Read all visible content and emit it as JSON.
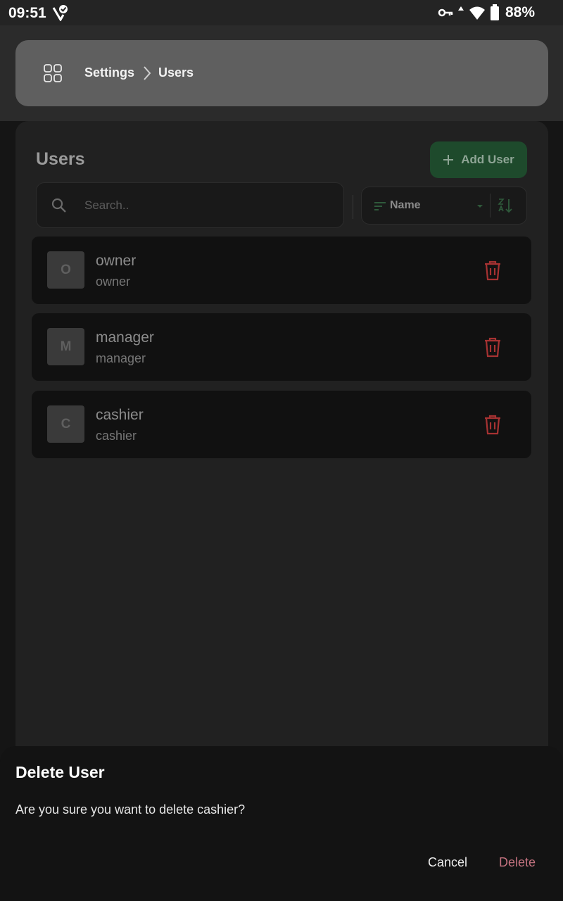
{
  "status_bar": {
    "time": "09:51",
    "battery": "88%"
  },
  "breadcrumb": {
    "items": [
      "Settings",
      "Users"
    ]
  },
  "page": {
    "title": "Users",
    "add_button_label": "Add User"
  },
  "search": {
    "placeholder": "Search..",
    "value": ""
  },
  "sort": {
    "selected": "Name"
  },
  "users": [
    {
      "initial": "O",
      "name": "owner",
      "role": "owner"
    },
    {
      "initial": "M",
      "name": "manager",
      "role": "manager"
    },
    {
      "initial": "C",
      "name": "cashier",
      "role": "cashier"
    }
  ],
  "dialog": {
    "title": "Delete User",
    "message": "Are you sure you want to delete cashier?",
    "cancel_label": "Cancel",
    "delete_label": "Delete"
  },
  "colors": {
    "accent_green": "#1e4a2c",
    "danger_red": "#b03a3a",
    "delete_text": "#c3727f"
  }
}
